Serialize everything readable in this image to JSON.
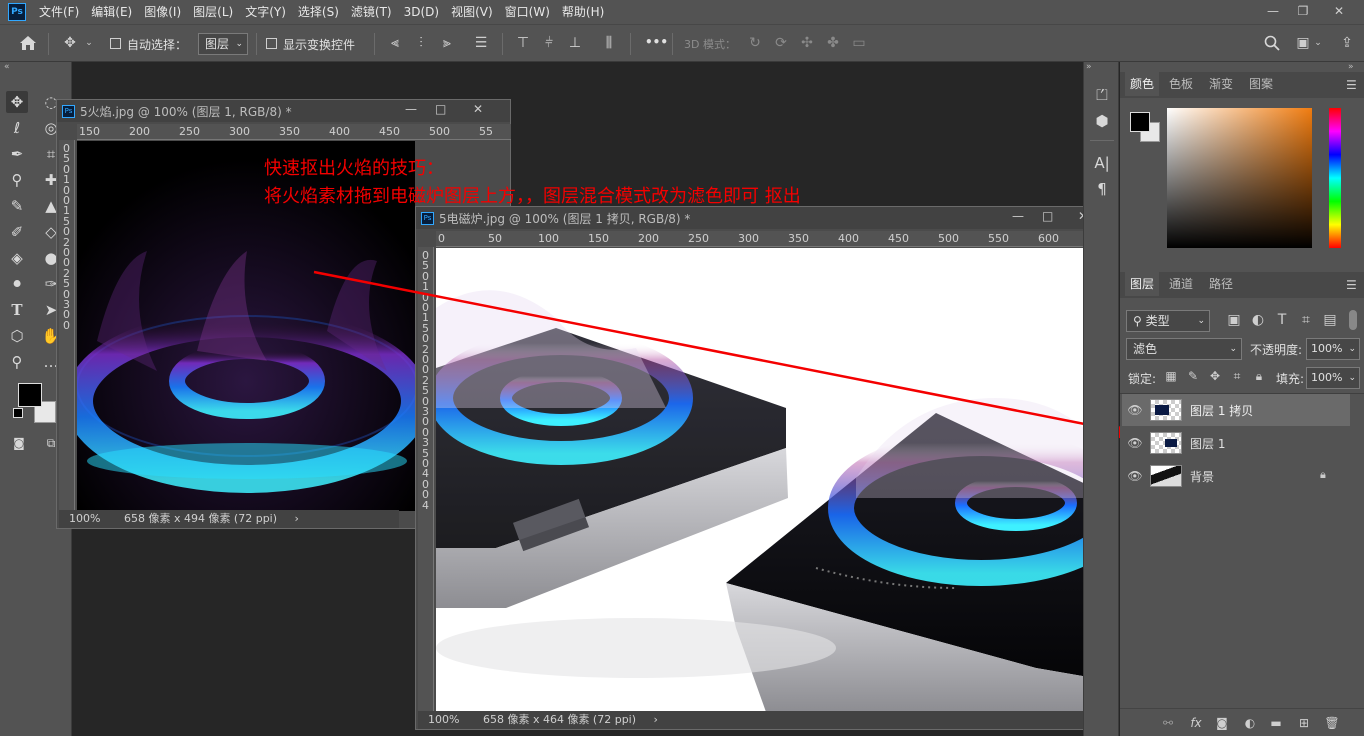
{
  "app": {
    "logo_text": "Ps"
  },
  "menubar": {
    "items": [
      "文件(F)",
      "编辑(E)",
      "图像(I)",
      "图层(L)",
      "文字(Y)",
      "选择(S)",
      "滤镜(T)",
      "3D(D)",
      "视图(V)",
      "窗口(W)",
      "帮助(H)"
    ]
  },
  "window_controls": {
    "minimize": "—",
    "restore": "❐",
    "close": "✕"
  },
  "options": {
    "auto_select_label": "自动选择：",
    "auto_select_value": "图层",
    "show_transform_label": "显示变换控件",
    "more_label": "•••",
    "mode_3d_label": "3D 模式："
  },
  "doc1": {
    "title": "5火焰.jpg @ 100% (图层 1, RGB/8) *",
    "zoom": "100%",
    "size_info": "658 像素 x 494 像素 (72 ppi)",
    "ruler_h": [
      "150",
      "200",
      "250",
      "300",
      "350",
      "400",
      "450",
      "500",
      "55"
    ],
    "ruler_v": [
      "0",
      "5",
      "0",
      "1",
      "0",
      "0",
      "1",
      "5",
      "0",
      "2",
      "0",
      "0",
      "2",
      "5",
      "0",
      "3",
      "0",
      "0"
    ]
  },
  "doc2": {
    "title": "5电磁炉.jpg @ 100% (图层 1 拷贝, RGB/8) *",
    "zoom": "100%",
    "size_info": "658 像素 x 464 像素 (72 ppi)",
    "ruler_h": [
      "0",
      "50",
      "100",
      "150",
      "200",
      "250",
      "300",
      "350",
      "400",
      "450",
      "500",
      "550",
      "600",
      "6"
    ],
    "ruler_v": [
      "0",
      "5",
      "0",
      "1",
      "0",
      "0",
      "1",
      "5",
      "0",
      "2",
      "0",
      "0",
      "2",
      "5",
      "0",
      "3",
      "0",
      "0",
      "3",
      "5",
      "0",
      "4",
      "0",
      "0",
      "4"
    ]
  },
  "annotation": {
    "line1": "快速抠出火焰的技巧：",
    "line2": "将火焰素材拖到电磁炉图层上方，，图层混合模式改为滤色即可    抠出",
    "color": "#f40000"
  },
  "color_panel": {
    "tabs": [
      "颜色",
      "色板",
      "渐变",
      "图案"
    ]
  },
  "layers_panel": {
    "tabs": [
      "图层",
      "通道",
      "路径"
    ],
    "filter_label": "类型",
    "blend_mode": "滤色",
    "opacity_label": "不透明度:",
    "opacity_value": "100%",
    "lock_label": "锁定:",
    "fill_label": "填充:",
    "fill_value": "100%",
    "layers": [
      {
        "name": "图层 1 拷贝",
        "selected": true
      },
      {
        "name": "图层 1",
        "selected": false
      },
      {
        "name": "背景",
        "selected": false
      }
    ]
  },
  "colors": {
    "accent": "#31a8ff",
    "annotation": "#f40000",
    "panel": "#535353",
    "canvas_bg": "#262626"
  }
}
